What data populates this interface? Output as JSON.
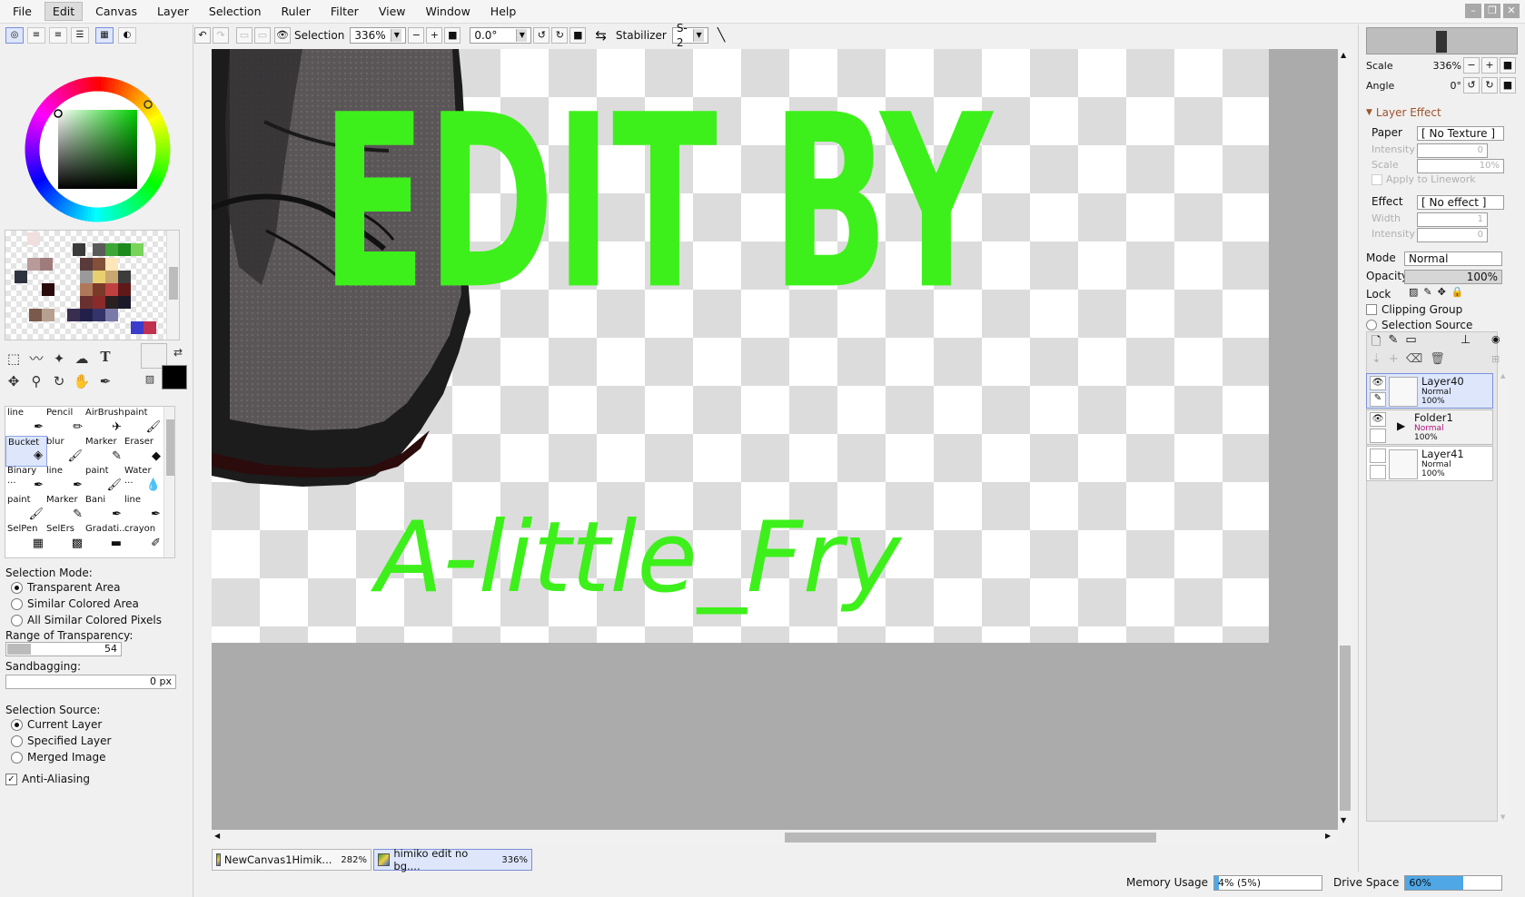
{
  "menu": [
    "File",
    "Edit",
    "Canvas",
    "Layer",
    "Selection",
    "Ruler",
    "Filter",
    "View",
    "Window",
    "Help"
  ],
  "toolbar": {
    "selection_label": "Selection",
    "zoom_value": "336%",
    "rotation_value": "0.0°",
    "stabilizer_label": "Stabilizer",
    "stabilizer_value": "S-2"
  },
  "tools": [
    {
      "label": "line",
      "icon": "pen-icon"
    },
    {
      "label": "Pencil",
      "icon": "pencil-icon"
    },
    {
      "label": "AirBrush",
      "icon": "airbrush-icon"
    },
    {
      "label": "paint",
      "icon": "brush-icon"
    },
    {
      "label": "Bucket",
      "icon": "bucket-icon",
      "selected": true
    },
    {
      "label": "blur",
      "icon": "brush-icon"
    },
    {
      "label": "Marker",
      "icon": "marker-icon"
    },
    {
      "label": "Eraser",
      "icon": "eraser-icon"
    },
    {
      "label": "Binary ...",
      "icon": "pen-icon"
    },
    {
      "label": "line",
      "icon": "pen-icon"
    },
    {
      "label": "paint",
      "icon": "brush-icon"
    },
    {
      "label": "Water ...",
      "icon": "watercolor-icon"
    },
    {
      "label": "paint",
      "icon": "brush-icon"
    },
    {
      "label": "Marker",
      "icon": "marker-icon"
    },
    {
      "label": "Bani",
      "icon": "pen-icon"
    },
    {
      "label": "line",
      "icon": "pen-icon"
    },
    {
      "label": "SelPen",
      "icon": "selpen-icon"
    },
    {
      "label": "SelErs",
      "icon": "selerase-icon"
    },
    {
      "label": "Gradati...",
      "icon": "gradient-icon"
    },
    {
      "label": "crayon",
      "icon": "crayon-icon"
    }
  ],
  "tool_settings": {
    "selection_mode_label": "Selection Mode:",
    "selection_modes": [
      "Transparent Area",
      "Similar Colored Area",
      "All Similar Colored Pixels"
    ],
    "selected_mode": 0,
    "range_label": "Range of Transparency:",
    "range_value": "54",
    "range_fraction": 0.21,
    "sandbagging_label": "Sandbagging:",
    "sandbagging_value": "0 px",
    "source_label": "Selection Source:",
    "sources": [
      "Current Layer",
      "Specified Layer",
      "Merged Image"
    ],
    "selected_source": 0,
    "antialias_label": "Anti-Aliasing",
    "antialias_checked": true
  },
  "canvas_text": {
    "line1": "EDIT BY",
    "line2": "A-little_Fry",
    "color": "#3ef01b"
  },
  "tabs": [
    {
      "name": "NewCanvas1Himik...",
      "zoom": "282%",
      "active": false
    },
    {
      "name": "himiko edit no bg....",
      "zoom": "336%",
      "active": true
    }
  ],
  "status": {
    "memory_label": "Memory Usage",
    "memory_value": "4% (5%)",
    "memory_fraction": 0.04,
    "drive_label": "Drive Space",
    "drive_value": "60%",
    "drive_fraction": 0.6
  },
  "navigator": {
    "scale_label": "Scale",
    "scale_value": "336%",
    "angle_label": "Angle",
    "angle_value": "0°"
  },
  "layer_effect": {
    "title": "Layer Effect",
    "paper_label": "Paper",
    "paper_value": "[ No Texture ]",
    "intensity_label": "Intensity",
    "intensity_value": "0",
    "scale_label": "Scale",
    "scale_value": "10%",
    "apply_label": "Apply to Linework",
    "effect_label": "Effect",
    "effect_value": "[ No effect ]",
    "width_label": "Width",
    "width_value": "1",
    "intensity2_label": "Intensity",
    "intensity2_value": "0"
  },
  "layer_props": {
    "mode_label": "Mode",
    "mode_value": "Normal",
    "opacity_label": "Opacity",
    "opacity_value": "100%",
    "lock_label": "Lock",
    "clipping_label": "Clipping Group",
    "source_label": "Selection Source"
  },
  "layers": [
    {
      "name": "Layer40",
      "mode": "Normal",
      "opacity": "100%",
      "selected": true,
      "visible": true
    },
    {
      "name": "Folder1",
      "mode": "Normal",
      "opacity": "100%",
      "selected": false,
      "visible": true,
      "folder": true
    },
    {
      "name": "Layer41",
      "mode": "Normal",
      "opacity": "100%",
      "selected": false,
      "visible": false
    }
  ],
  "colors": {
    "accent_selected": "#dde6fb",
    "drive_bar": "#4fa7e6",
    "folder_mode": "#b0137a"
  }
}
